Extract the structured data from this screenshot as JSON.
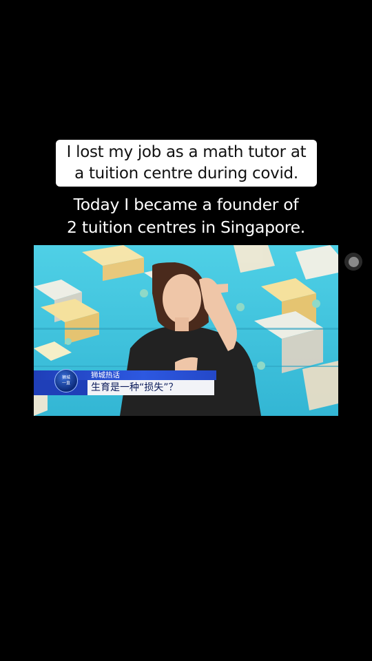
{
  "captions": {
    "top_box": "I lost my job as a math tutor at\na tuition centre during covid.",
    "overlay": "Today I became a founder of\n2 tuition centres in Singapore."
  },
  "video": {
    "lower_third": {
      "logo_text": "狮城\n一直",
      "program_name": "狮城热话",
      "headline": "生育是一种“损失”？"
    }
  },
  "colors": {
    "background": "#000000",
    "caption_box": "#ffffff",
    "video_backdrop": "#3fc6dc",
    "lower_third_blue": "#1f3fb8"
  },
  "icons": {
    "floating_button": "record-dot-icon"
  }
}
